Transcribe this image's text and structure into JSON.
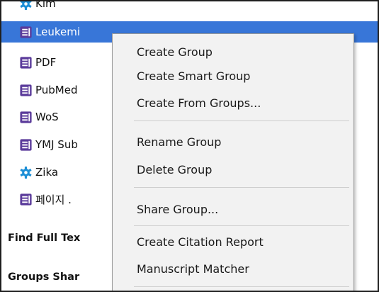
{
  "colors": {
    "selection_background": "#3876d8",
    "library_icon_color": "#5a3a9a",
    "smart_group_icon_color": "#1d8fd6",
    "menu_background": "#f2f2f2"
  },
  "sidebar": {
    "groups": [
      {
        "label": "Kim",
        "icon": "smart-group-gear-icon",
        "selected": false
      },
      {
        "label": "Leukemi",
        "icon": "group-library-icon",
        "selected": true
      },
      {
        "label": "PDF",
        "icon": "group-library-icon",
        "selected": false
      },
      {
        "label": "PubMed",
        "icon": "group-library-icon",
        "selected": false
      },
      {
        "label": "WoS",
        "icon": "group-library-icon",
        "selected": false
      },
      {
        "label": "YMJ Sub",
        "icon": "group-library-icon",
        "selected": false
      },
      {
        "label": "Zika",
        "icon": "smart-group-gear-icon",
        "selected": false
      },
      {
        "label": "페이지 .",
        "icon": "group-library-icon",
        "selected": false
      }
    ],
    "sections": {
      "find_full_text": "Find Full Tex",
      "groups_shared": "Groups Shar"
    }
  },
  "context_menu": {
    "items": [
      "Create Group",
      "Create Smart Group",
      "Create From Groups...",
      "Rename Group",
      "Delete Group",
      "Share Group...",
      "Create Citation Report",
      "Manuscript Matcher"
    ]
  }
}
